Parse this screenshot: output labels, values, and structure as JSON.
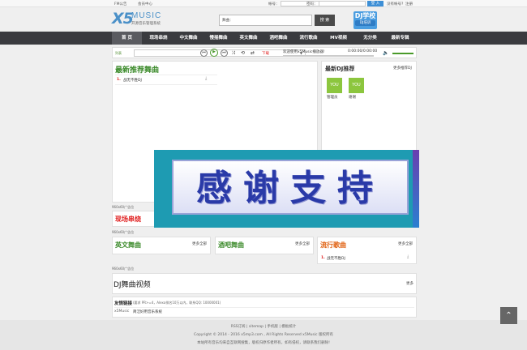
{
  "topbar": {
    "announce": "FM公告",
    "member_center": "会员中心",
    "account_label": "帐号：",
    "password_label": "密码：",
    "login_btn": "登 入",
    "no_account": "没有帐号?",
    "register": "注册"
  },
  "logo": {
    "x5": "X5",
    "music": "MUSIC",
    "sub": "开源音乐管理系统"
  },
  "search": {
    "label": "舞曲：",
    "button": "搜 索"
  },
  "djbadge": {
    "title": "DJ学校",
    "sub": "DJ培训"
  },
  "nav": [
    "首 页",
    "现场串烧",
    "中文舞曲",
    "慢摇舞曲",
    "英文舞曲",
    "酒吧舞曲",
    "流行歌曲",
    "MV视频",
    "无分类",
    "最新专辑"
  ],
  "player": {
    "list_label": "列表",
    "download": "下载",
    "status": "欢迎使用x5Music播放器!",
    "time": "0:00:00/0:00:00"
  },
  "latest": {
    "title": "最新推荐舞曲",
    "items": [
      {
        "num": "1.",
        "name": "战无不胜DJ"
      }
    ]
  },
  "djrec": {
    "title": "最新DJ推荐",
    "more": "更多推荐DJ",
    "users": [
      {
        "img": "YOU",
        "name": "管理员"
      },
      {
        "img": "YOU",
        "name": "谢谢"
      }
    ]
  },
  "ads": {
    "ad1": "960x60广告位",
    "ad2": "960x60广告位",
    "ad3": "960x60广告位"
  },
  "live": {
    "title": "现场串烧"
  },
  "cat_english": {
    "title": "英文舞曲",
    "more": "更多全部"
  },
  "cat_bar": {
    "title": "酒吧舞曲",
    "more": "更多全部"
  },
  "cat_pop": {
    "title": "流行歌曲",
    "more": "更多全部",
    "items": [
      {
        "num": "1.",
        "name": "战无不胜DJ"
      }
    ]
  },
  "video": {
    "title": "DJ舞曲视频",
    "more": "更多"
  },
  "links": {
    "title": "友情链接",
    "note": "(要求 PR>=4，Alexa排名10万以内，联系QQ: 10000001)",
    "items": [
      {
        "name": "x5Music",
        "desc": "简洁好用音乐系统"
      }
    ]
  },
  "overlay": {
    "text": "感谢支持"
  },
  "footer": {
    "line1": "RSS订阅 | sitemap | 手机版 | 模板统计",
    "line2": "Copyright © 2014 - 2016 x5mp3.com , All Rights Reserved x5Music 版权所有",
    "line3": "本站所有音乐均来自互联网搜集，版权归原作者所有，如有侵权，请联系我们删除!"
  },
  "totop": "^"
}
